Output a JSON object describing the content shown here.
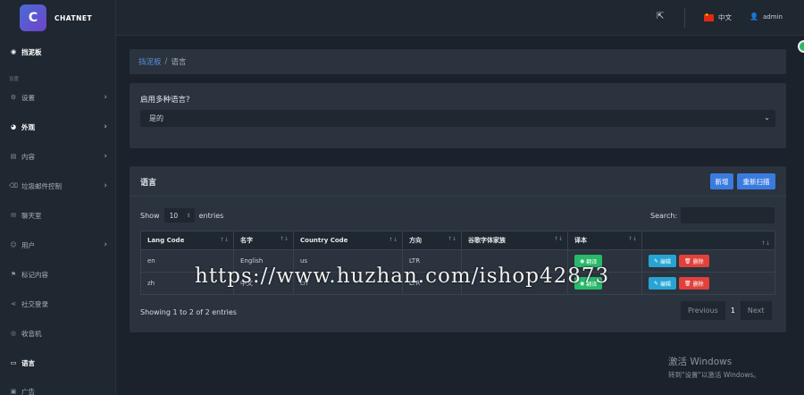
{
  "app": {
    "logo_letter": "C",
    "name": "CHATNET"
  },
  "sidebar": {
    "section_label": "设置",
    "items": [
      {
        "label": "挡泥板",
        "icon": "dashboard-icon",
        "active": true,
        "chevron": false
      },
      {
        "label": "设置",
        "icon": "gear-icon",
        "active": false,
        "chevron": true
      },
      {
        "label": "外观",
        "icon": "palette-icon",
        "active": false,
        "chevron": true
      },
      {
        "label": "内容",
        "icon": "content-icon",
        "active": false,
        "chevron": true
      },
      {
        "label": "垃圾邮件控制",
        "icon": "spam-icon",
        "active": false,
        "chevron": true
      },
      {
        "label": "聊天室",
        "icon": "chat-icon",
        "active": false,
        "chevron": false
      },
      {
        "label": "用户",
        "icon": "users-icon",
        "active": false,
        "chevron": true
      },
      {
        "label": "标记内容",
        "icon": "flag-icon",
        "active": false,
        "chevron": false
      },
      {
        "label": "社交登录",
        "icon": "share-icon",
        "active": false,
        "chevron": false
      },
      {
        "label": "收音机",
        "icon": "radio-icon",
        "active": false,
        "chevron": false
      },
      {
        "label": "语言",
        "icon": "language-icon",
        "active": true,
        "chevron": false
      },
      {
        "label": "广告",
        "icon": "ad-icon",
        "active": false,
        "chevron": false
      }
    ]
  },
  "header": {
    "language": "中文",
    "user": "admin"
  },
  "breadcrumb": {
    "home": "挡泥板",
    "separator": "/",
    "current": "语言"
  },
  "multi_language": {
    "label": "启用多种语言?",
    "selected": "是的"
  },
  "languages_table": {
    "title": "语言",
    "add_label": "新增",
    "rescan_label": "重新扫描",
    "show_label": "Show",
    "entries_count": "10",
    "entries_label": "entries",
    "search_label": "Search:",
    "columns": [
      "Lang Code",
      "名字",
      "Country Code",
      "方向",
      "谷歌字体家族",
      "译本",
      ""
    ],
    "rows": [
      {
        "lang_code": "en",
        "name": "English",
        "country_code": "us",
        "direction": "LTR",
        "font": "",
        "translate_label": "翻译",
        "edit_label": "编辑",
        "delete_label": "删除"
      },
      {
        "lang_code": "zh",
        "name": "中文",
        "country_code": "cn",
        "direction": "LTR",
        "font": "",
        "translate_label": "翻译",
        "edit_label": "编辑",
        "delete_label": "删除"
      }
    ],
    "info": "Showing 1 to 2 of 2 entries",
    "pager": {
      "prev": "Previous",
      "current": "1",
      "next": "Next"
    }
  },
  "overlay": {
    "watermark_url": "https://www.huzhan.com/ishop42873",
    "windows_title": "激活 Windows",
    "windows_subtitle": "转到\"设置\"以激活 Windows。"
  },
  "colors": {
    "accent": "#3a7be0",
    "translate": "#28b96a",
    "edit": "#27a4d4",
    "delete": "#e0413a"
  }
}
